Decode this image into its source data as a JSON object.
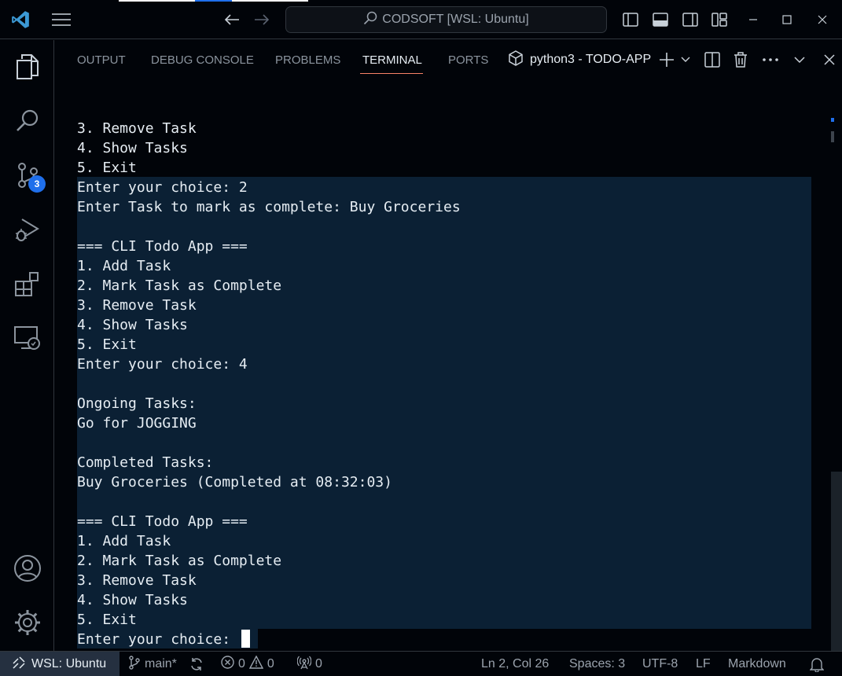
{
  "titlebar": {
    "command_center": "CODSOFT [WSL: Ubuntu]",
    "icons": [
      "vscode-logo",
      "hamburger-menu-icon",
      "arrow-left-icon",
      "arrow-right-icon",
      "search-icon",
      "toggle-primary-sidebar-icon",
      "toggle-panel-icon",
      "toggle-secondary-sidebar-icon",
      "customize-layout-icon",
      "minimize-icon",
      "maximize-icon",
      "close-icon"
    ]
  },
  "activitybar": {
    "items": [
      "explorer-icon",
      "search-icon",
      "source-control-icon",
      "run-debug-icon",
      "extensions-icon",
      "remote-explorer-icon",
      "accounts-icon",
      "manage-gear-icon"
    ],
    "source_control_badge": "3"
  },
  "panel": {
    "tabs": [
      {
        "label": "OUTPUT"
      },
      {
        "label": "DEBUG CONSOLE"
      },
      {
        "label": "PROBLEMS"
      },
      {
        "label": "TERMINAL",
        "active": true
      },
      {
        "label": "PORTS"
      }
    ],
    "terminal_name": "python3 - TODO-APP"
  },
  "terminal": {
    "lines": [
      "3. Remove Task",
      "4. Show Tasks",
      "5. Exit",
      "Enter your choice: 2",
      "Enter Task to mark as complete: Buy Groceries",
      "",
      "=== CLI Todo App ===",
      "1. Add Task",
      "2. Mark Task as Complete",
      "3. Remove Task",
      "4. Show Tasks",
      "5. Exit",
      "Enter your choice: 4",
      "",
      "Ongoing Tasks:",
      "Go for JOGGING",
      "",
      "Completed Tasks:",
      "Buy Groceries (Completed at 08:32:03)",
      "",
      "=== CLI Todo App ===",
      "1. Add Task",
      "2. Mark Task as Complete",
      "3. Remove Task",
      "4. Show Tasks",
      "5. Exit",
      "Enter your choice: "
    ]
  },
  "statusbar": {
    "remote": "WSL: Ubuntu",
    "branch": "main*",
    "errors": "0",
    "warnings": "0",
    "ports": "0",
    "position": "Ln 2, Col 26",
    "spaces": "Spaces: 3",
    "encoding": "UTF-8",
    "eol": "LF",
    "language": "Markdown"
  },
  "colors": {
    "background": "#010409",
    "selection": "#0b2034",
    "accent": "#1f6feb",
    "tab_underline": "#f78166",
    "remote_indicator": "#253040"
  }
}
